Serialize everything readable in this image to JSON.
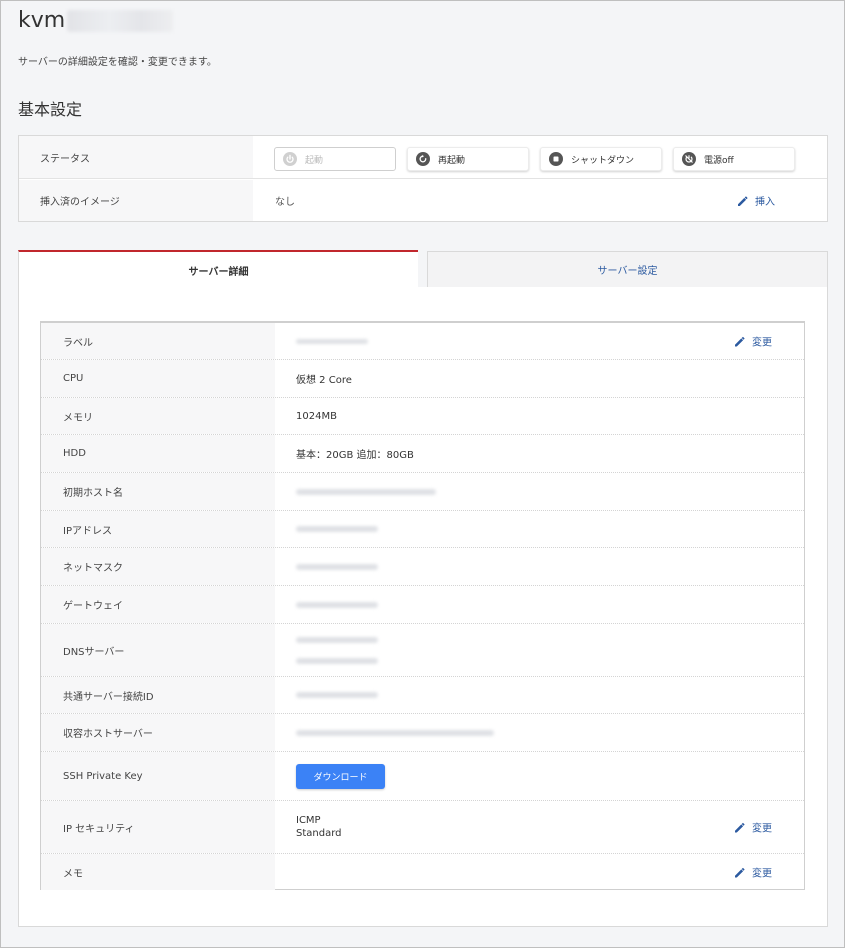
{
  "header": {
    "title": "kvm",
    "subtitle": "サーバーの詳細設定を確認・変更できます。"
  },
  "basic": {
    "section_title": "基本設定",
    "status_label": "ステータス",
    "buttons": {
      "start": "起動",
      "restart": "再起動",
      "shutdown": "シャットダウン",
      "power_off": "電源off"
    },
    "image_label": "挿入済のイメージ",
    "image_value": "なし",
    "insert_label": "挿入"
  },
  "tabs": {
    "details": "サーバー詳細",
    "settings": "サーバー設定"
  },
  "details": {
    "label": "ラベル",
    "cpu_label": "CPU",
    "cpu_value": "仮想 2 Core",
    "memory_label": "メモリ",
    "memory_value": "1024MB",
    "hdd_label": "HDD",
    "hdd_value": "基本：20GB 追加：80GB",
    "hostname_label": "初期ホスト名",
    "ip_label": "IPアドレス",
    "netmask_label": "ネットマスク",
    "gateway_label": "ゲートウェイ",
    "dns_label": "DNSサーバー",
    "shared_label": "共通サーバー接続ID",
    "host_server_label": "収容ホストサーバー",
    "ssh_label": "SSH Private Key",
    "download_label": "ダウンロード",
    "ip_security_label": "IP セキュリティ",
    "ip_security_line1": "ICMP",
    "ip_security_line2": "Standard",
    "memo_label": "メモ",
    "edit_label": "変更"
  },
  "colors": {
    "accent_red": "#c1272d",
    "link_blue": "#2c5aa0",
    "button_blue": "#3b82f6"
  }
}
